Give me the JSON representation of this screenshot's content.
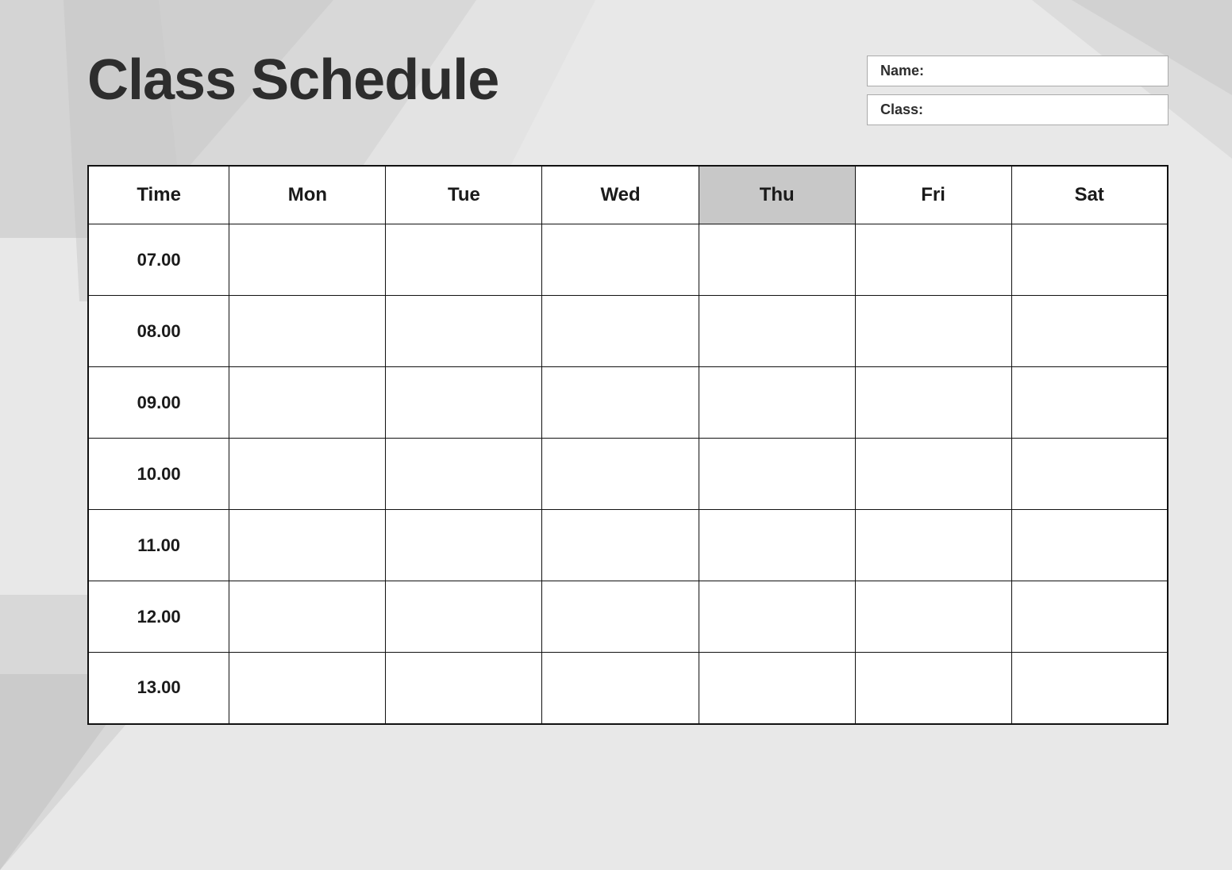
{
  "title": "Class Schedule",
  "fields": {
    "name_label": "Name:",
    "class_label": "Class:"
  },
  "table": {
    "headers": [
      "Time",
      "Mon",
      "Tue",
      "Wed",
      "Thu",
      "Fri",
      "Sat"
    ],
    "rows": [
      {
        "time": "07.00"
      },
      {
        "time": "08.00"
      },
      {
        "time": "09.00"
      },
      {
        "time": "10.00"
      },
      {
        "time": "11.00"
      },
      {
        "time": "12.00"
      },
      {
        "time": "13.00"
      }
    ]
  }
}
